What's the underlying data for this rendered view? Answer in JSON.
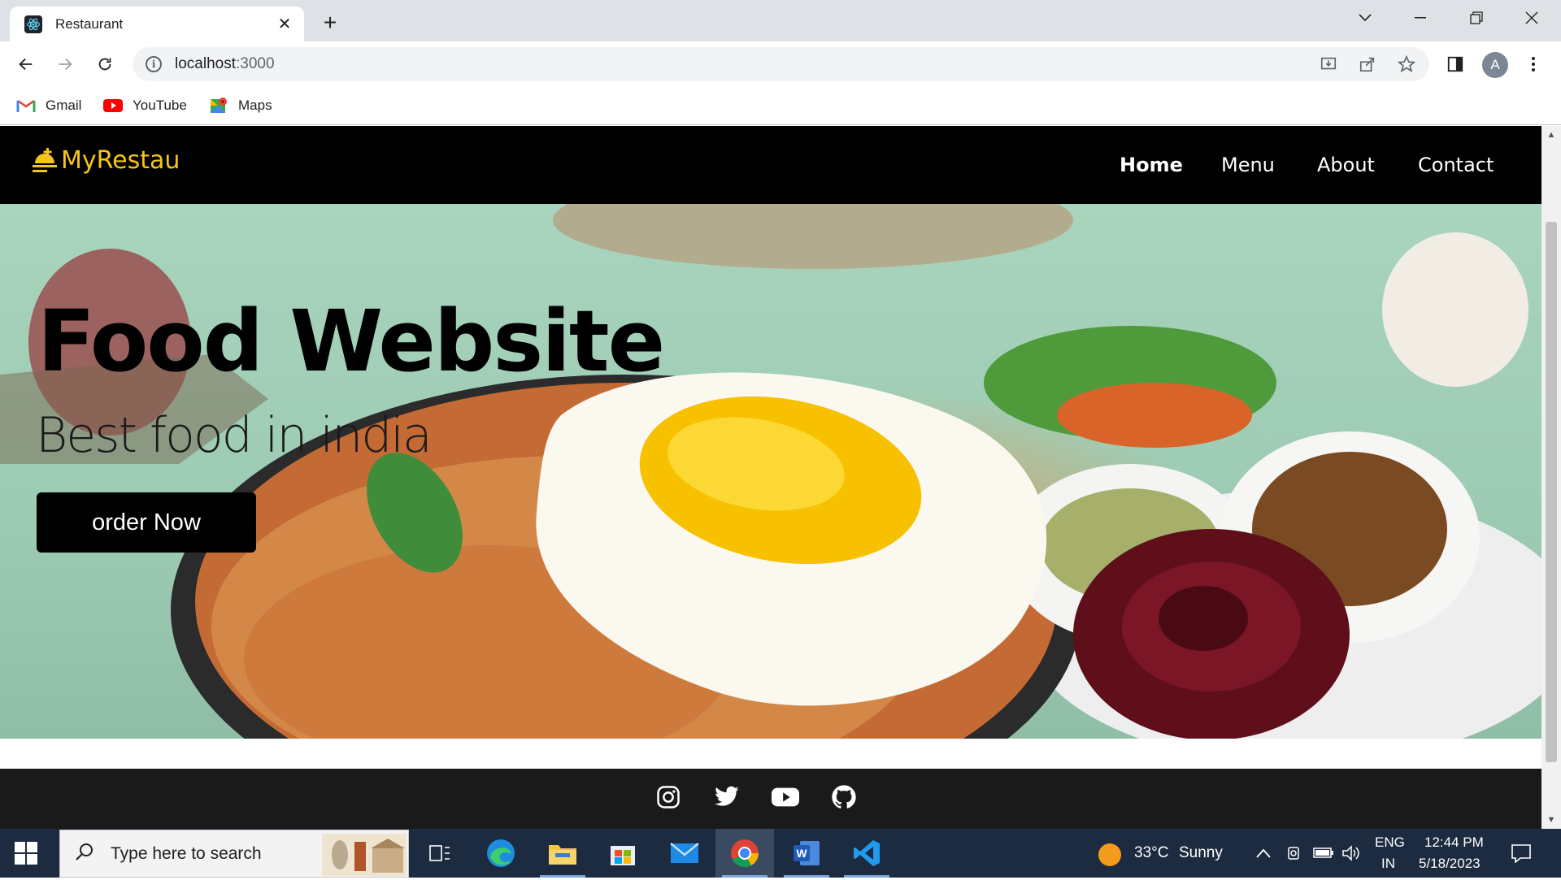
{
  "browser": {
    "tab_title": "Restaurant",
    "tab_close": "✕",
    "new_tab": "+",
    "url_host": "localhost",
    "url_port": ":3000",
    "profile_initial": "A",
    "bookmarks": [
      {
        "label": "Gmail"
      },
      {
        "label": "YouTube"
      },
      {
        "label": "Maps"
      }
    ]
  },
  "site": {
    "logo_text": "MyRestau",
    "nav": [
      {
        "label": "Home",
        "active": true
      },
      {
        "label": "Menu",
        "active": false
      },
      {
        "label": "About",
        "active": false
      },
      {
        "label": "Contact",
        "active": false
      }
    ],
    "hero": {
      "title": "Food Website",
      "subtitle": "Best food in india",
      "cta": "order Now"
    },
    "footer_icons": [
      "instagram-icon",
      "twitter-icon",
      "youtube-icon",
      "github-icon"
    ]
  },
  "taskbar": {
    "search_placeholder": "Type here to search",
    "weather_temp": "33°C",
    "weather_desc": "Sunny",
    "lang_1": "ENG",
    "lang_2": "IN",
    "time": "12:44 PM",
    "date": "5/18/2023"
  },
  "colors": {
    "logo": "#f5c518",
    "nav_bg": "#000000",
    "hero_bg": "#a9d4bd",
    "footer_bg": "#1a1a1a",
    "taskbar_bg": "#1c2b3f"
  }
}
